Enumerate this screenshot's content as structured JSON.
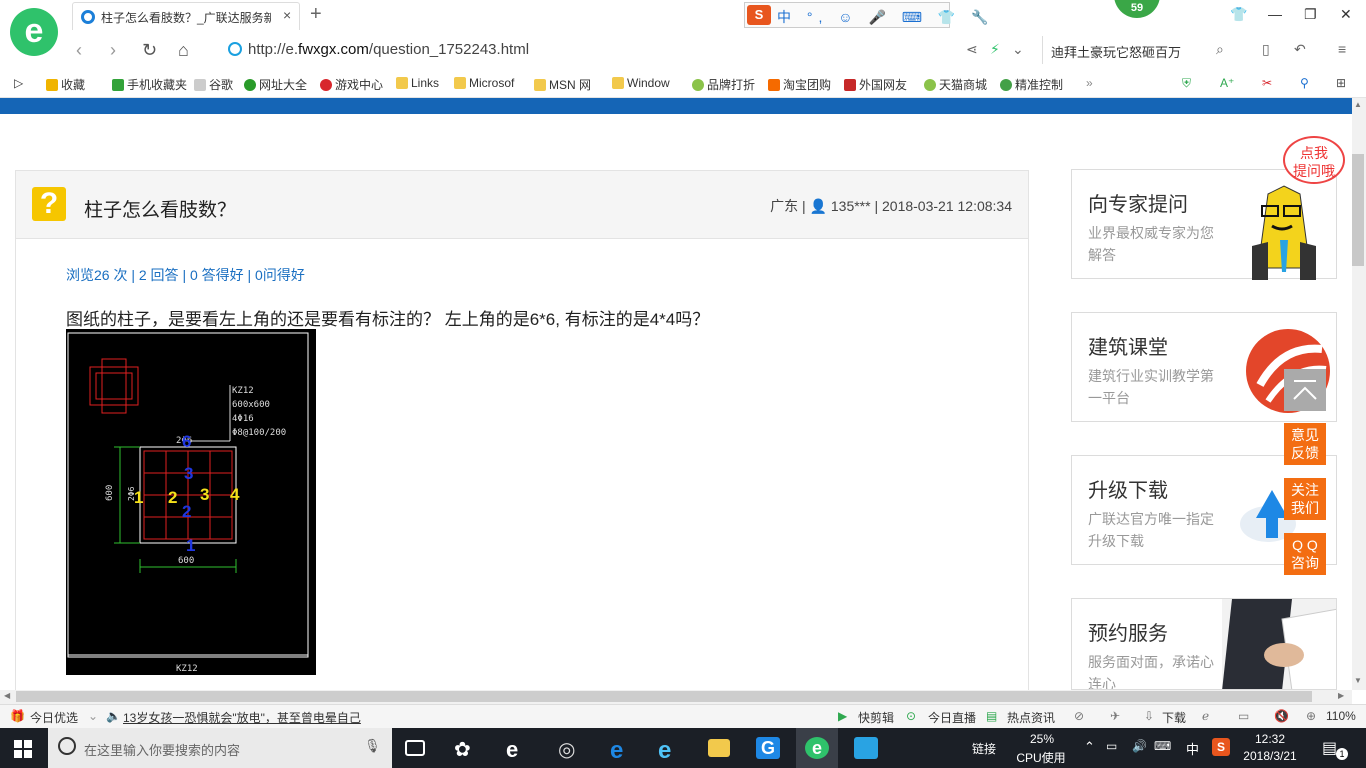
{
  "browser": {
    "logo_letter": "e",
    "tab_title": "柱子怎么看肢数？_广联达服务新",
    "tab_close": "×",
    "new_tab": "+",
    "ime_logo": "S",
    "ime_items": "中 °, ☺ 🎤 ⌨ 👕 🔧",
    "badge_count": "59",
    "url_prefix": "http://e.",
    "url_domain": "fwxgx.com",
    "url_path": "/question_1752243.html",
    "search_hint": "迪拜土豪玩它怒砸百万"
  },
  "favorites": [
    {
      "label": "收藏",
      "color": "#f0b400"
    },
    {
      "label": "手机收藏夹",
      "color": "#33a33a"
    },
    {
      "label": "谷歌",
      "color": "#cccccc"
    },
    {
      "label": "网址大全",
      "color": "#2a9b2a"
    },
    {
      "label": "游戏中心",
      "color": "#d8262c"
    },
    {
      "label": "Links",
      "color": "#f2c94c"
    },
    {
      "label": "Microsof",
      "color": "#f2c94c"
    },
    {
      "label": "MSN 网",
      "color": "#f2c94c"
    },
    {
      "label": "Window",
      "color": "#f2c94c"
    },
    {
      "label": "品牌打折",
      "color": "#8bc34a"
    },
    {
      "label": "淘宝团购",
      "color": "#f56a00"
    },
    {
      "label": "外国网友",
      "color": "#c62828"
    },
    {
      "label": "天猫商城",
      "color": "#8bc34a"
    },
    {
      "label": "精准控制",
      "color": "#43a047"
    }
  ],
  "question": {
    "title": "柱子怎么看肢数？",
    "meta": "广东 | 👤 135*** | 2018-03-21 12:08:34",
    "stats": "浏览26 次 | 2 回答 | 0 答得好 | 0问得好",
    "body": "图纸的柱子，是要看左上角的还是要看有标注的？  左上角的是6*6, 有标注的是4*4吗？"
  },
  "cad": {
    "note": [
      "KZ12",
      "600x600",
      "4Φ16",
      "Φ8@100/200"
    ],
    "dim_top": "2Φ6",
    "dim_left": "600",
    "dim_left2": "2Φ6",
    "dim_bottom": "600",
    "yellow_nums": [
      "1",
      "2",
      "3",
      "4"
    ],
    "blue_nums": [
      "6",
      "3",
      "2",
      "1"
    ],
    "footer_label": "KZ12"
  },
  "sidebar": [
    {
      "title": "向专家提问",
      "sub": "业界最权威专家为您解答"
    },
    {
      "title": "建筑课堂",
      "sub": "建筑行业实训教学第一平台"
    },
    {
      "title": "升级下载",
      "sub": "广联达官方唯一指定升级下载"
    },
    {
      "title": "预约服务",
      "sub": "服务面对面，承诺心连心"
    }
  ],
  "bubble": "点我\n提问哦",
  "float_buttons": [
    "意见\n反馈",
    "关注\n我们",
    "Q Q\n咨询"
  ],
  "status": {
    "today": "今日优选",
    "news": "13岁女孩一恐惧就会\"放电\"，甚至曾电晕自己",
    "clip": "快剪辑",
    "live": "今日直播",
    "hot": "热点资讯",
    "download": "下载",
    "zoom": "110%"
  },
  "taskbar": {
    "search_placeholder": "在这里输入你要搜索的内容",
    "link_label": "链接",
    "cpu_percent": "25%",
    "cpu_label": "CPU使用",
    "ime": "中",
    "time": "12:32",
    "date": "2018/3/21",
    "notification_count": "1"
  }
}
